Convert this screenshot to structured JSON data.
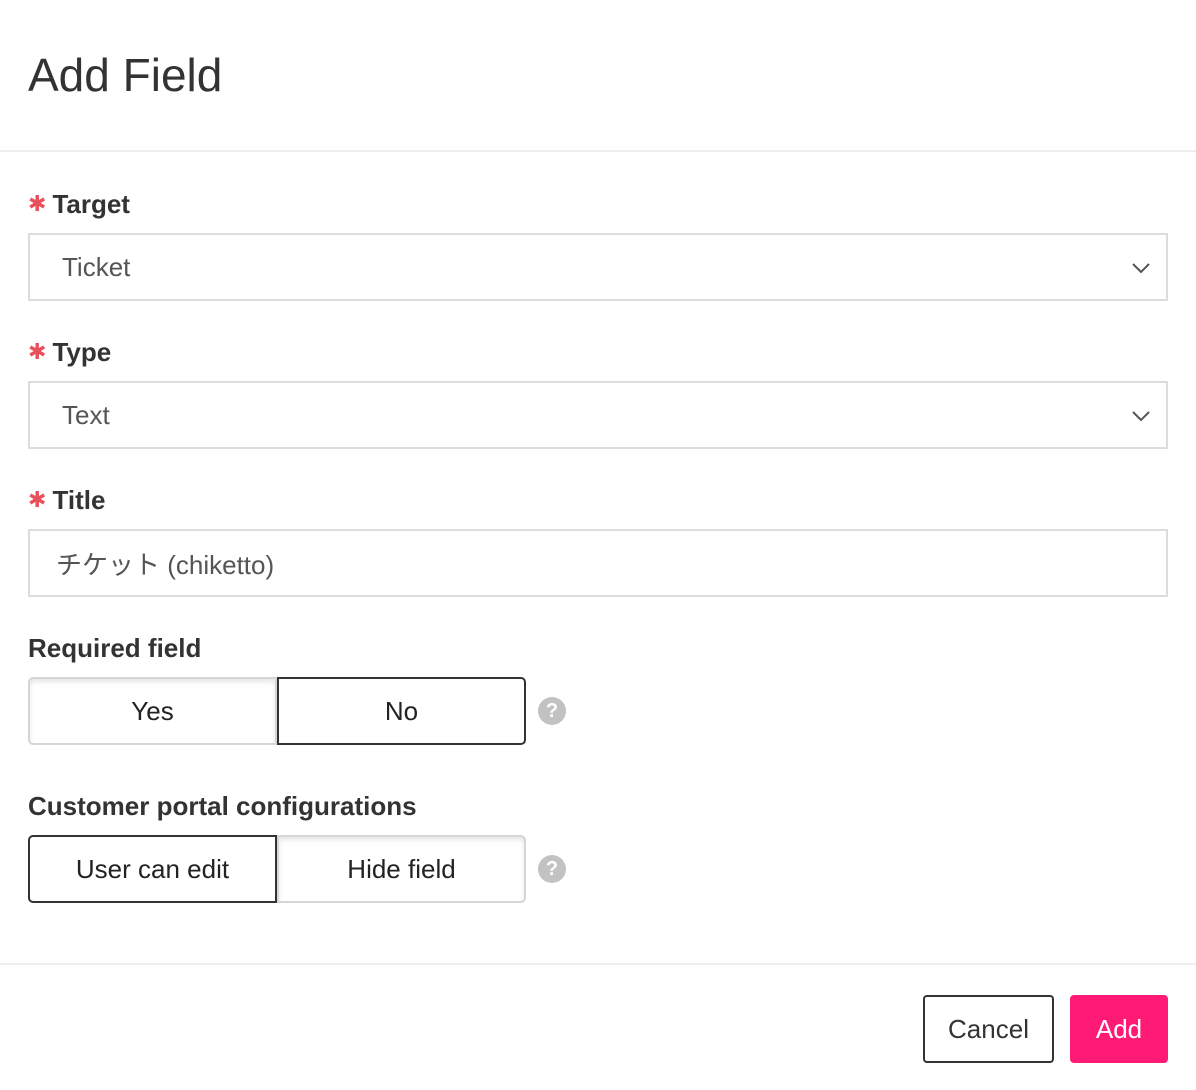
{
  "dialog": {
    "title": "Add Field"
  },
  "required_marker": "✱",
  "icons": {
    "required": "asterisk-icon",
    "select_arrow": "chevron-down-icon",
    "help": "help-circle-icon"
  },
  "fields": {
    "target": {
      "label": "Target",
      "value": "Ticket"
    },
    "type": {
      "label": "Type",
      "value": "Text"
    },
    "title": {
      "label": "Title",
      "value": "チケット (chiketto)"
    },
    "required_field": {
      "label": "Required field",
      "options": [
        "Yes",
        "No"
      ],
      "selected": "No",
      "help": "?"
    },
    "portal": {
      "label": "Customer portal configurations",
      "options": [
        "User can edit",
        "Hide field"
      ],
      "selected": "User can edit",
      "help": "?"
    }
  },
  "footer": {
    "cancel_label": "Cancel",
    "add_label": "Add"
  },
  "colors": {
    "required_marker": "#e8505b",
    "primary_button": "#ff1a75",
    "help_icon": "#c2c2c2"
  }
}
